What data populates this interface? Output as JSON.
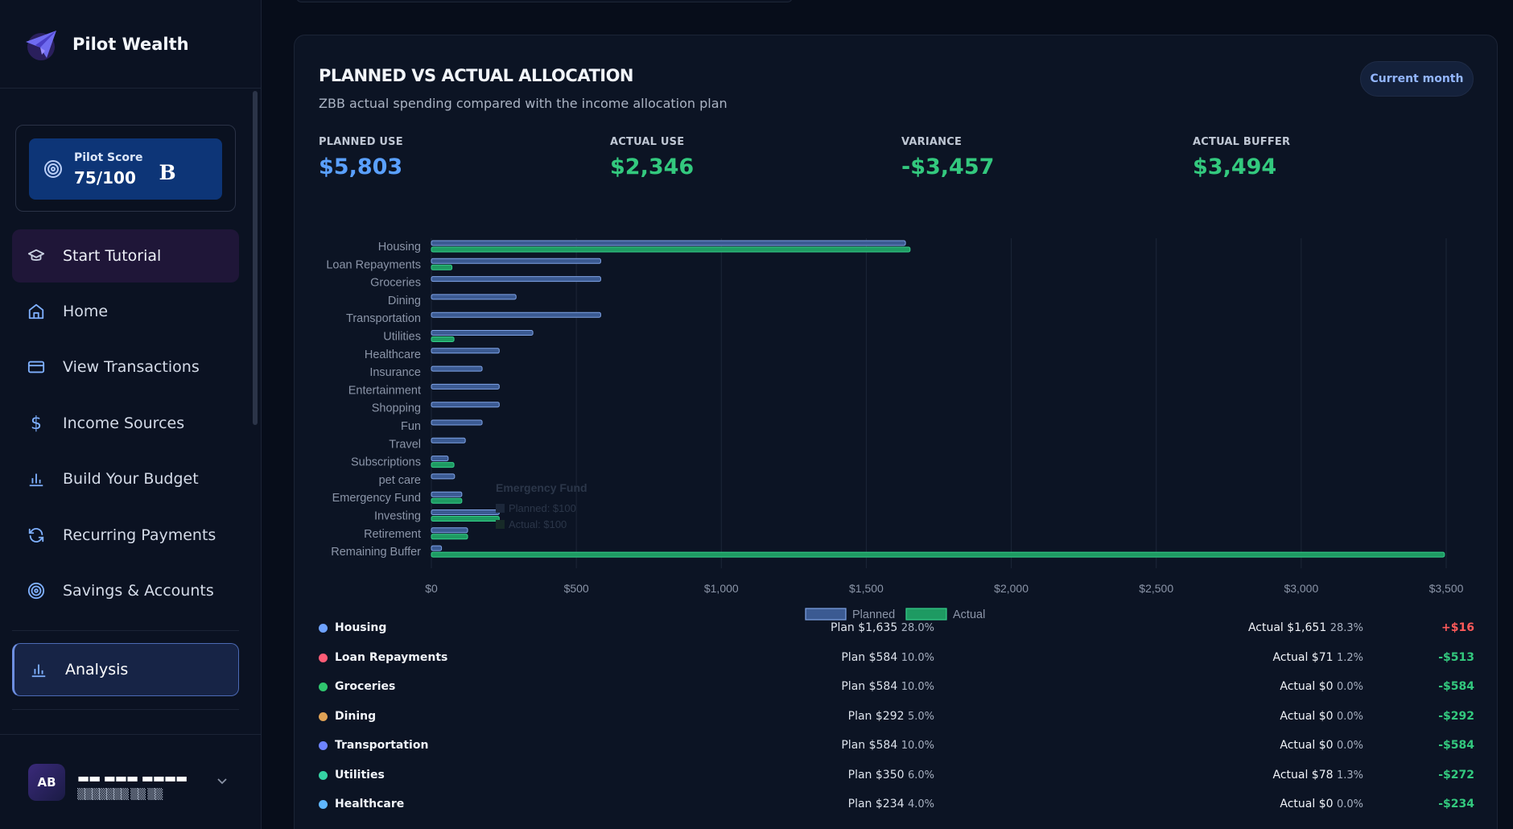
{
  "app": {
    "name": "Pilot Wealth"
  },
  "score": {
    "label": "Pilot Score",
    "value": "75/100",
    "badge": "B"
  },
  "nav": {
    "tutorial": "Start Tutorial",
    "home": "Home",
    "transactions": "View Transactions",
    "income": "Income Sources",
    "budget": "Build Your Budget",
    "recurring": "Recurring Payments",
    "savings": "Savings & Accounts",
    "analysis": "Analysis"
  },
  "user": {
    "initials": "AB",
    "name": "▬▬ ▬▬▬ ▬▬▬▬",
    "email": "▒▒▒▒▒▒▒ ▒▒ ▒▒"
  },
  "panel": {
    "title": "PLANNED VS ACTUAL ALLOCATION",
    "subtitle": "ZBB actual spending compared with the income allocation plan",
    "period": "Current month"
  },
  "stats": [
    {
      "label": "PLANNED USE",
      "value": "$5,803",
      "color": "#5aa0ff"
    },
    {
      "label": "ACTUAL USE",
      "value": "$2,346",
      "color": "#33c97e"
    },
    {
      "label": "VARIANCE",
      "value": "-$3,457",
      "color": "#33c97e"
    },
    {
      "label": "ACTUAL BUFFER",
      "value": "$3,494",
      "color": "#33c97e"
    }
  ],
  "colors": {
    "planned": "#3b5a92",
    "planned_border": "#7fa3e6",
    "actual": "#1e9a62",
    "actual_border": "#35d08b",
    "positive": "#ff5a5a",
    "negative": "#33c97e"
  },
  "chart_data": {
    "type": "bar",
    "orientation": "horizontal",
    "categories": [
      "Housing",
      "Loan Repayments",
      "Groceries",
      "Dining",
      "Transportation",
      "Utilities",
      "Healthcare",
      "Insurance",
      "Entertainment",
      "Shopping",
      "Fun",
      "Travel",
      "Subscriptions",
      "pet care",
      "Emergency Fund",
      "Investing",
      "Retirement",
      "Remaining Buffer"
    ],
    "series": [
      {
        "name": "Planned",
        "values": [
          1635,
          584,
          584,
          292,
          584,
          350,
          234,
          175,
          234,
          234,
          175,
          117,
          58,
          80,
          105,
          234,
          125,
          35
        ]
      },
      {
        "name": "Actual",
        "values": [
          1651,
          71,
          0,
          0,
          0,
          78,
          0,
          0,
          0,
          0,
          0,
          0,
          78,
          0,
          105,
          234,
          125,
          3494
        ]
      }
    ],
    "x_ticks": [
      "$0",
      "$500",
      "$1,000",
      "$1,500",
      "$2,000",
      "$2,500",
      "$3,000",
      "$3,500"
    ],
    "xlim": [
      0,
      3500
    ],
    "grid": true,
    "legend": "bottom-center",
    "tooltip": {
      "title": "Emergency Fund",
      "planned": "Planned: $100",
      "actual": "Actual: $100"
    }
  },
  "allocations": [
    {
      "name": "Housing",
      "dot": "#6ea2ff",
      "plan": "Plan $1,635",
      "plan_pct": "28.0%",
      "actual": "Actual $1,651",
      "actual_pct": "28.3%",
      "variance": "+$16",
      "var_color": "#ff5a5a"
    },
    {
      "name": "Loan Repayments",
      "dot": "#ff5c76",
      "plan": "Plan $584",
      "plan_pct": "10.0%",
      "actual": "Actual $71",
      "actual_pct": "1.2%",
      "variance": "-$513",
      "var_color": "#33c97e"
    },
    {
      "name": "Groceries",
      "dot": "#2fc56e",
      "plan": "Plan $584",
      "plan_pct": "10.0%",
      "actual": "Actual $0",
      "actual_pct": "0.0%",
      "variance": "-$584",
      "var_color": "#33c97e"
    },
    {
      "name": "Dining",
      "dot": "#e0a255",
      "plan": "Plan $292",
      "plan_pct": "5.0%",
      "actual": "Actual $0",
      "actual_pct": "0.0%",
      "variance": "-$292",
      "var_color": "#33c97e"
    },
    {
      "name": "Transportation",
      "dot": "#6d83ff",
      "plan": "Plan $584",
      "plan_pct": "10.0%",
      "actual": "Actual $0",
      "actual_pct": "0.0%",
      "variance": "-$584",
      "var_color": "#33c97e"
    },
    {
      "name": "Utilities",
      "dot": "#35d3a4",
      "plan": "Plan $350",
      "plan_pct": "6.0%",
      "actual": "Actual $78",
      "actual_pct": "1.3%",
      "variance": "-$272",
      "var_color": "#33c97e"
    },
    {
      "name": "Healthcare",
      "dot": "#5fb7ff",
      "plan": "Plan $234",
      "plan_pct": "4.0%",
      "actual": "Actual $0",
      "actual_pct": "0.0%",
      "variance": "-$234",
      "var_color": "#33c97e"
    }
  ]
}
